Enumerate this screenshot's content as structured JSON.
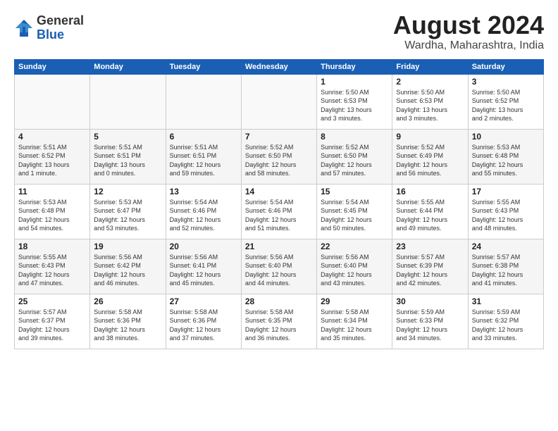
{
  "logo": {
    "general": "General",
    "blue": "Blue"
  },
  "title": "August 2024",
  "subtitle": "Wardha, Maharashtra, India",
  "days_header": [
    "Sunday",
    "Monday",
    "Tuesday",
    "Wednesday",
    "Thursday",
    "Friday",
    "Saturday"
  ],
  "weeks": [
    [
      {
        "num": "",
        "info": ""
      },
      {
        "num": "",
        "info": ""
      },
      {
        "num": "",
        "info": ""
      },
      {
        "num": "",
        "info": ""
      },
      {
        "num": "1",
        "info": "Sunrise: 5:50 AM\nSunset: 6:53 PM\nDaylight: 13 hours\nand 3 minutes."
      },
      {
        "num": "2",
        "info": "Sunrise: 5:50 AM\nSunset: 6:53 PM\nDaylight: 13 hours\nand 3 minutes."
      },
      {
        "num": "3",
        "info": "Sunrise: 5:50 AM\nSunset: 6:52 PM\nDaylight: 13 hours\nand 2 minutes."
      }
    ],
    [
      {
        "num": "4",
        "info": "Sunrise: 5:51 AM\nSunset: 6:52 PM\nDaylight: 13 hours\nand 1 minute."
      },
      {
        "num": "5",
        "info": "Sunrise: 5:51 AM\nSunset: 6:51 PM\nDaylight: 13 hours\nand 0 minutes."
      },
      {
        "num": "6",
        "info": "Sunrise: 5:51 AM\nSunset: 6:51 PM\nDaylight: 12 hours\nand 59 minutes."
      },
      {
        "num": "7",
        "info": "Sunrise: 5:52 AM\nSunset: 6:50 PM\nDaylight: 12 hours\nand 58 minutes."
      },
      {
        "num": "8",
        "info": "Sunrise: 5:52 AM\nSunset: 6:50 PM\nDaylight: 12 hours\nand 57 minutes."
      },
      {
        "num": "9",
        "info": "Sunrise: 5:52 AM\nSunset: 6:49 PM\nDaylight: 12 hours\nand 56 minutes."
      },
      {
        "num": "10",
        "info": "Sunrise: 5:53 AM\nSunset: 6:48 PM\nDaylight: 12 hours\nand 55 minutes."
      }
    ],
    [
      {
        "num": "11",
        "info": "Sunrise: 5:53 AM\nSunset: 6:48 PM\nDaylight: 12 hours\nand 54 minutes."
      },
      {
        "num": "12",
        "info": "Sunrise: 5:53 AM\nSunset: 6:47 PM\nDaylight: 12 hours\nand 53 minutes."
      },
      {
        "num": "13",
        "info": "Sunrise: 5:54 AM\nSunset: 6:46 PM\nDaylight: 12 hours\nand 52 minutes."
      },
      {
        "num": "14",
        "info": "Sunrise: 5:54 AM\nSunset: 6:46 PM\nDaylight: 12 hours\nand 51 minutes."
      },
      {
        "num": "15",
        "info": "Sunrise: 5:54 AM\nSunset: 6:45 PM\nDaylight: 12 hours\nand 50 minutes."
      },
      {
        "num": "16",
        "info": "Sunrise: 5:55 AM\nSunset: 6:44 PM\nDaylight: 12 hours\nand 49 minutes."
      },
      {
        "num": "17",
        "info": "Sunrise: 5:55 AM\nSunset: 6:43 PM\nDaylight: 12 hours\nand 48 minutes."
      }
    ],
    [
      {
        "num": "18",
        "info": "Sunrise: 5:55 AM\nSunset: 6:43 PM\nDaylight: 12 hours\nand 47 minutes."
      },
      {
        "num": "19",
        "info": "Sunrise: 5:56 AM\nSunset: 6:42 PM\nDaylight: 12 hours\nand 46 minutes."
      },
      {
        "num": "20",
        "info": "Sunrise: 5:56 AM\nSunset: 6:41 PM\nDaylight: 12 hours\nand 45 minutes."
      },
      {
        "num": "21",
        "info": "Sunrise: 5:56 AM\nSunset: 6:40 PM\nDaylight: 12 hours\nand 44 minutes."
      },
      {
        "num": "22",
        "info": "Sunrise: 5:56 AM\nSunset: 6:40 PM\nDaylight: 12 hours\nand 43 minutes."
      },
      {
        "num": "23",
        "info": "Sunrise: 5:57 AM\nSunset: 6:39 PM\nDaylight: 12 hours\nand 42 minutes."
      },
      {
        "num": "24",
        "info": "Sunrise: 5:57 AM\nSunset: 6:38 PM\nDaylight: 12 hours\nand 41 minutes."
      }
    ],
    [
      {
        "num": "25",
        "info": "Sunrise: 5:57 AM\nSunset: 6:37 PM\nDaylight: 12 hours\nand 39 minutes."
      },
      {
        "num": "26",
        "info": "Sunrise: 5:58 AM\nSunset: 6:36 PM\nDaylight: 12 hours\nand 38 minutes."
      },
      {
        "num": "27",
        "info": "Sunrise: 5:58 AM\nSunset: 6:36 PM\nDaylight: 12 hours\nand 37 minutes."
      },
      {
        "num": "28",
        "info": "Sunrise: 5:58 AM\nSunset: 6:35 PM\nDaylight: 12 hours\nand 36 minutes."
      },
      {
        "num": "29",
        "info": "Sunrise: 5:58 AM\nSunset: 6:34 PM\nDaylight: 12 hours\nand 35 minutes."
      },
      {
        "num": "30",
        "info": "Sunrise: 5:59 AM\nSunset: 6:33 PM\nDaylight: 12 hours\nand 34 minutes."
      },
      {
        "num": "31",
        "info": "Sunrise: 5:59 AM\nSunset: 6:32 PM\nDaylight: 12 hours\nand 33 minutes."
      }
    ]
  ]
}
